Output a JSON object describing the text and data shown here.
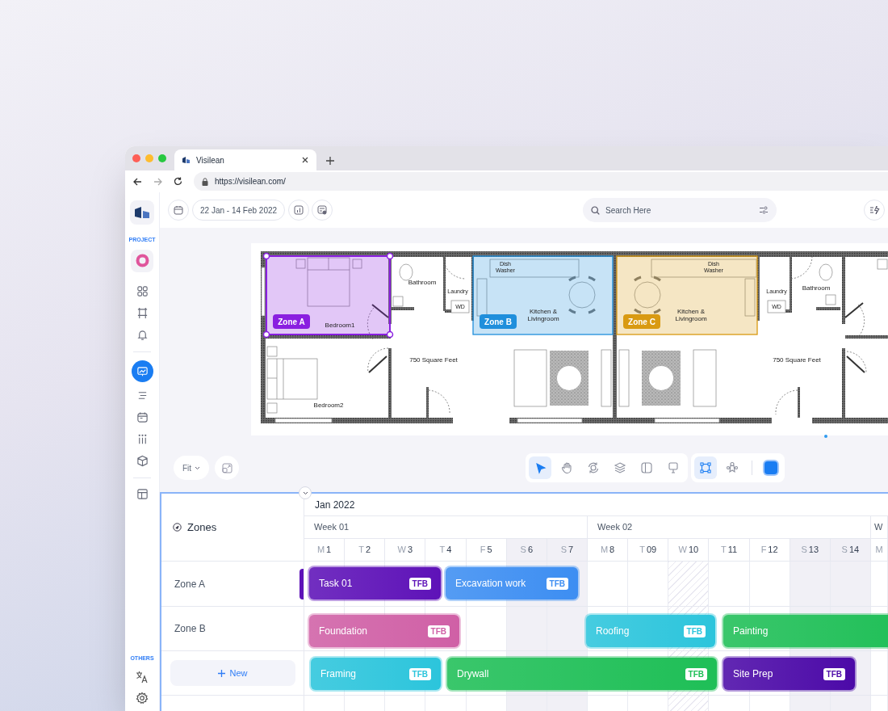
{
  "browser": {
    "tab_title": "Visilean",
    "url": "https://visilean.com/"
  },
  "sidebar": {
    "project_label": "PROJECT",
    "items": [
      {
        "selected": false
      },
      {
        "selected": false
      },
      {
        "selected": false
      },
      {
        "selected": true
      },
      {
        "selected": false
      },
      {
        "selected": false
      },
      {
        "selected": false
      },
      {
        "selected": false
      },
      {
        "selected": false
      }
    ],
    "others_label": "OTHERS"
  },
  "top_bar": {
    "date_range": "22 Jan - 14 Feb 2022",
    "search": {
      "placeholder": "Search Here"
    }
  },
  "floor_plan": {
    "labels": [
      {
        "lines": [
          "Bathroom"
        ]
      },
      {
        "lines": [
          "Laundry"
        ]
      },
      {
        "lines": [
          "WD"
        ]
      },
      {
        "lines": [
          "Dish",
          "Washer"
        ]
      },
      {
        "lines": [
          "Kitchen &",
          "Livingroom"
        ]
      },
      {
        "lines": [
          "Bedroom1"
        ]
      },
      {
        "lines": [
          "750 Square Feet"
        ]
      },
      {
        "lines": [
          "Bedroom2"
        ]
      },
      {
        "lines": [
          "Dish",
          "Washer"
        ]
      },
      {
        "lines": [
          "Kitchen &",
          "Livingroom"
        ]
      },
      {
        "lines": [
          "Laundry"
        ]
      },
      {
        "lines": [
          "WD"
        ]
      },
      {
        "lines": [
          "Bathroom"
        ]
      },
      {
        "lines": [
          "750 Square Feet"
        ]
      }
    ],
    "zones": [
      {
        "label": "Zone A",
        "color": "#8a1fe0",
        "selected": true
      },
      {
        "label": "Zone B",
        "color": "#1f8fdc",
        "selected": false
      },
      {
        "label": "Zone C",
        "color": "#d99a12",
        "selected": false
      }
    ]
  },
  "view_controls": {
    "zoom": "Fit",
    "tools": [
      {
        "selected": true
      },
      {
        "selected": false
      },
      {
        "selected": false
      },
      {
        "selected": false
      },
      {
        "selected": false
      },
      {
        "selected": false
      },
      {
        "selected": true
      },
      {
        "selected": false
      }
    ]
  },
  "schedule": {
    "title": "Zones",
    "month": "Jan 2022",
    "weeks": [
      "Week 01",
      "Week 02",
      "W"
    ],
    "days": [
      {
        "letter": "M",
        "number": "1",
        "kind": "weekday"
      },
      {
        "letter": "T",
        "number": "2",
        "kind": "weekday"
      },
      {
        "letter": "W",
        "number": "3",
        "kind": "weekday"
      },
      {
        "letter": "T",
        "number": "4",
        "kind": "weekday"
      },
      {
        "letter": "F",
        "number": "5",
        "kind": "weekday"
      },
      {
        "letter": "S",
        "number": "6",
        "kind": "weekend"
      },
      {
        "letter": "S",
        "number": "7",
        "kind": "weekend"
      },
      {
        "letter": "M",
        "number": "8",
        "kind": "weekday"
      },
      {
        "letter": "T",
        "number": "09",
        "kind": "weekday"
      },
      {
        "letter": "W",
        "number": "10",
        "kind": "hatched"
      },
      {
        "letter": "T",
        "number": "11",
        "kind": "weekday"
      },
      {
        "letter": "F",
        "number": "12",
        "kind": "weekday"
      },
      {
        "letter": "S",
        "number": "13",
        "kind": "weekend"
      },
      {
        "letter": "S",
        "number": "14",
        "kind": "weekend"
      },
      {
        "letter": "M",
        "kind": "weekday"
      }
    ],
    "rows": [
      {
        "zone": "Zone A",
        "tasks": [
          {
            "name": "Task 01",
            "badge": "TFB",
            "color": "#5e12b8"
          },
          {
            "name": "Excavation work",
            "badge": "TFB",
            "color": "#3d8ef2"
          }
        ]
      },
      {
        "zone": "Zone B",
        "tasks": [
          {
            "name": "Foundation",
            "badge": "TFB",
            "color": "#d060a6"
          },
          {
            "name": "Roofing",
            "badge": "TFB",
            "color": "#2cc5dc"
          },
          {
            "name": "Painting",
            "color": "#1fbf57"
          }
        ]
      },
      {
        "add_label": "New",
        "tasks": [
          {
            "name": "Framing",
            "badge": "TFB",
            "color": "#2cc5dc"
          },
          {
            "name": "Drywall",
            "badge": "TFB",
            "color": "#1fbf57"
          },
          {
            "name": "Site Prep",
            "badge": "TFB",
            "color": "#4c0aa8"
          }
        ]
      }
    ]
  }
}
